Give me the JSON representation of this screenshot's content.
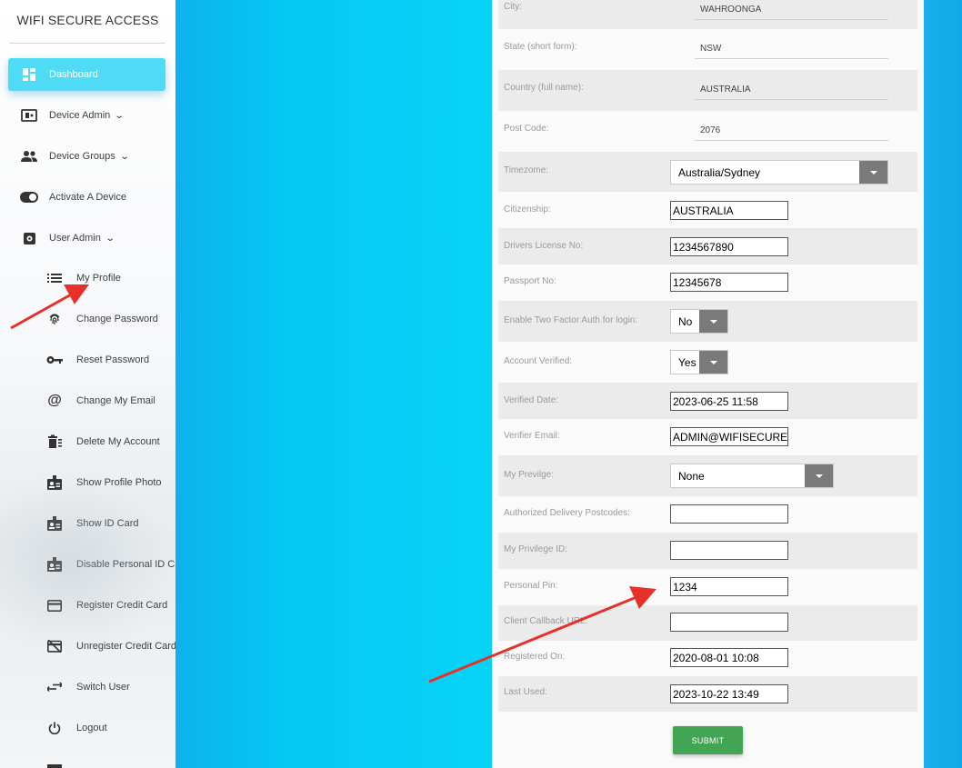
{
  "sidebar": {
    "brand": "WIFI SECURE ACCESS",
    "items": [
      {
        "label": "Dashboard",
        "icon": "dashboard-icon"
      },
      {
        "label": "Device Admin",
        "icon": "device-admin-icon"
      },
      {
        "label": "Device Groups",
        "icon": "groups-icon"
      },
      {
        "label": "Activate A Device",
        "icon": "toggle-icon"
      },
      {
        "label": "User Admin",
        "icon": "gear-icon"
      }
    ],
    "subitems": [
      {
        "label": "My Profile",
        "icon": "list-icon"
      },
      {
        "label": "Change Password",
        "icon": "fingerprint-icon"
      },
      {
        "label": "Reset Password",
        "icon": "key-icon"
      },
      {
        "label": "Change My Email",
        "icon": "at-icon"
      },
      {
        "label": "Delete My Account",
        "icon": "delete-icon"
      },
      {
        "label": "Show Profile Photo",
        "icon": "badge-icon"
      },
      {
        "label": "Show ID Card",
        "icon": "badge-icon"
      },
      {
        "label": "Disable Personal ID Card",
        "icon": "badge-icon"
      },
      {
        "label": "Register Credit Card",
        "icon": "credit-card-icon"
      },
      {
        "label": "Unregister Credit Card",
        "icon": "credit-card-off-icon"
      },
      {
        "label": "Switch User",
        "icon": "switch-icon"
      },
      {
        "label": "Logout",
        "icon": "power-icon"
      }
    ]
  },
  "form": {
    "city": {
      "label": "City:",
      "value": "WAHROONGA"
    },
    "state": {
      "label": "State (short form):",
      "value": "NSW"
    },
    "country": {
      "label": "Country (full name):",
      "value": "AUSTRALIA"
    },
    "postcode": {
      "label": "Post Code:",
      "value": "2076"
    },
    "timezone": {
      "label": "Timezome:",
      "value": "Australia/Sydney"
    },
    "citizenship": {
      "label": "Citizenship:",
      "value": "AUSTRALIA"
    },
    "license": {
      "label": "Drivers License No:",
      "value": "1234567890"
    },
    "passport": {
      "label": "Passport No:",
      "value": "12345678"
    },
    "twofactor": {
      "label": "Enable Two Factor Auth for login:",
      "value": "No"
    },
    "verified": {
      "label": "Account Verified:",
      "value": "Yes"
    },
    "verified_date": {
      "label": "Verified Date:",
      "value": "2023-06-25 11:58"
    },
    "verifier_email": {
      "label": "Verifier Email:",
      "value": "ADMIN@WIFISECUREACCESS.COM"
    },
    "privilege": {
      "label": "My Previlge:",
      "value": "None"
    },
    "delivery": {
      "label": "Authorized Delivery Postcodes:",
      "value": ""
    },
    "privilege_id": {
      "label": "My Privilege ID:",
      "value": ""
    },
    "pin": {
      "label": "Personal Pin:",
      "value": "1234"
    },
    "callback": {
      "label": "Client Callback URL:",
      "value": ""
    },
    "registered": {
      "label": "Registered On:",
      "value": "2020-08-01 10:08"
    },
    "last_used": {
      "label": "Last Used:",
      "value": "2023-10-22 13:49"
    },
    "submit": "SUBMIT"
  },
  "colors": {
    "accent": "#4fdbf5",
    "submit": "#43a553",
    "annotation": "#e8302a"
  }
}
